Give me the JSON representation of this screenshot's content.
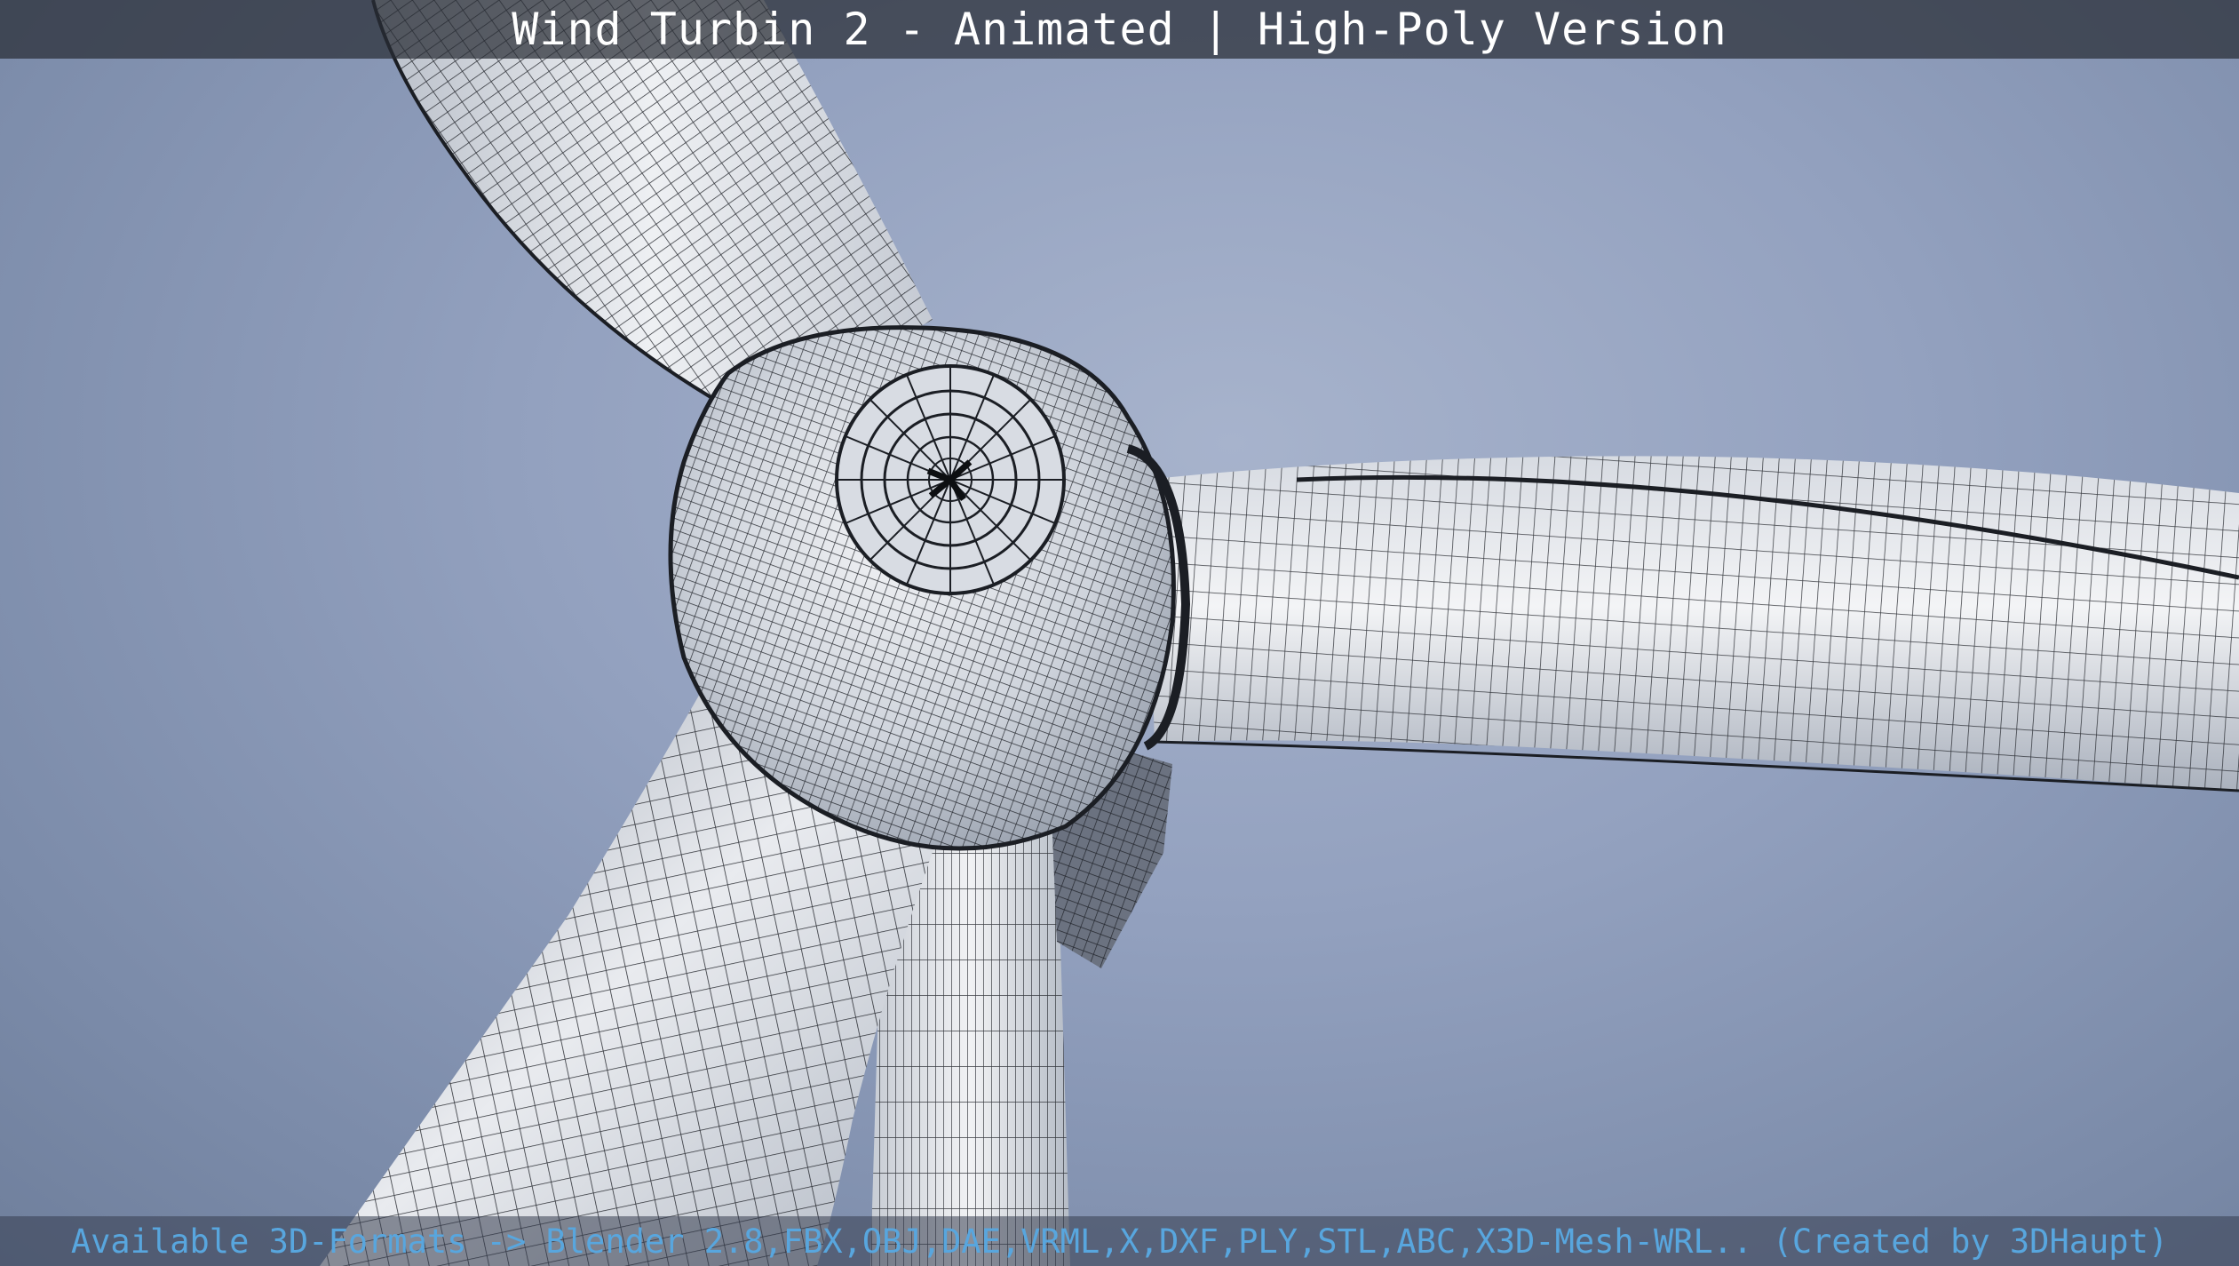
{
  "header": {
    "title": "Wind Turbin 2 - Animated | High-Poly Version"
  },
  "footer": {
    "formats_text": "Available 3D-Formats -> Blender 2.8,FBX,OBJ,DAE,VRML,X,DXF,PLY,STL,ABC,X3D-Mesh-WRL.. (Created by 3DHaupt)"
  },
  "scene": {
    "subject": "wind-turbine-hub-wireframe",
    "background_color": "#8c9cba",
    "mesh_fill_color": "#e4e7ec",
    "wire_color": "#1a1d22"
  }
}
